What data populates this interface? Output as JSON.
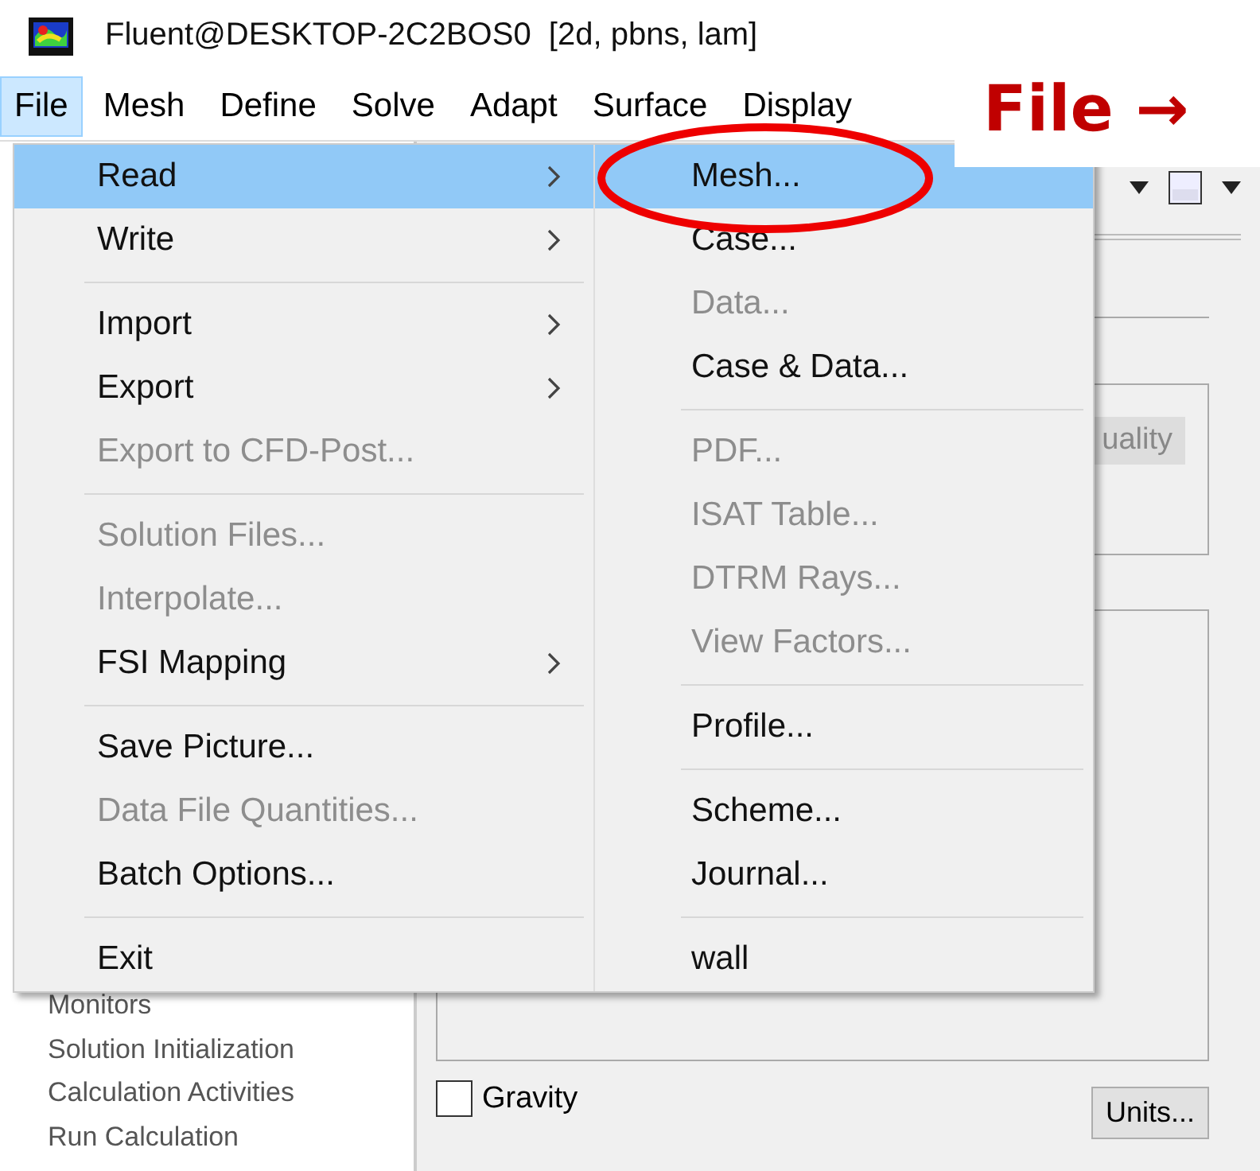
{
  "window": {
    "title": "Fluent@DESKTOP-2C2BOS0  [2d, pbns, lam]"
  },
  "menubar": [
    {
      "label": "File",
      "selected": true
    },
    {
      "label": "Mesh",
      "selected": false
    },
    {
      "label": "Define",
      "selected": false
    },
    {
      "label": "Solve",
      "selected": false
    },
    {
      "label": "Adapt",
      "selected": false
    },
    {
      "label": "Surface",
      "selected": false
    },
    {
      "label": "Display",
      "selected": false
    }
  ],
  "file_menu": [
    {
      "kind": "item",
      "label": "Read",
      "submenu": true,
      "disabled": false,
      "selected": true
    },
    {
      "kind": "item",
      "label": "Write",
      "submenu": true,
      "disabled": false,
      "selected": false
    },
    {
      "kind": "separator"
    },
    {
      "kind": "item",
      "label": "Import",
      "submenu": true,
      "disabled": false,
      "selected": false
    },
    {
      "kind": "item",
      "label": "Export",
      "submenu": true,
      "disabled": false,
      "selected": false
    },
    {
      "kind": "item",
      "label": "Export to CFD-Post...",
      "submenu": false,
      "disabled": true,
      "selected": false
    },
    {
      "kind": "separator"
    },
    {
      "kind": "item",
      "label": "Solution Files...",
      "submenu": false,
      "disabled": true,
      "selected": false
    },
    {
      "kind": "item",
      "label": "Interpolate...",
      "submenu": false,
      "disabled": true,
      "selected": false
    },
    {
      "kind": "item",
      "label": "FSI Mapping",
      "submenu": true,
      "disabled": false,
      "selected": false
    },
    {
      "kind": "separator"
    },
    {
      "kind": "item",
      "label": "Save Picture...",
      "submenu": false,
      "disabled": false,
      "selected": false
    },
    {
      "kind": "item",
      "label": "Data File Quantities...",
      "submenu": false,
      "disabled": true,
      "selected": false
    },
    {
      "kind": "item",
      "label": "Batch Options...",
      "submenu": false,
      "disabled": false,
      "selected": false
    },
    {
      "kind": "separator"
    },
    {
      "kind": "item",
      "label": "Exit",
      "submenu": false,
      "disabled": false,
      "selected": false
    }
  ],
  "read_submenu": [
    {
      "kind": "item",
      "label": "Mesh...",
      "disabled": false,
      "selected": true
    },
    {
      "kind": "item",
      "label": "Case...",
      "disabled": false,
      "selected": false
    },
    {
      "kind": "item",
      "label": "Data...",
      "disabled": true,
      "selected": false
    },
    {
      "kind": "item",
      "label": "Case & Data...",
      "disabled": false,
      "selected": false
    },
    {
      "kind": "separator"
    },
    {
      "kind": "item",
      "label": "PDF...",
      "disabled": true,
      "selected": false
    },
    {
      "kind": "item",
      "label": "ISAT Table...",
      "disabled": true,
      "selected": false
    },
    {
      "kind": "item",
      "label": "DTRM Rays...",
      "disabled": true,
      "selected": false
    },
    {
      "kind": "item",
      "label": "View Factors...",
      "disabled": true,
      "selected": false
    },
    {
      "kind": "separator"
    },
    {
      "kind": "item",
      "label": "Profile...",
      "disabled": false,
      "selected": false
    },
    {
      "kind": "separator"
    },
    {
      "kind": "item",
      "label": "Scheme...",
      "disabled": false,
      "selected": false
    },
    {
      "kind": "item",
      "label": "Journal...",
      "disabled": false,
      "selected": false
    },
    {
      "kind": "separator"
    },
    {
      "kind": "item",
      "label": "wall",
      "disabled": false,
      "selected": false
    }
  ],
  "sidebar": {
    "items": [
      "Monitors",
      "Solution Initialization",
      "Calculation Activities",
      "Run Calculation"
    ]
  },
  "panel": {
    "quality_button": "uality",
    "gravity": {
      "label": "Gravity",
      "checked": false
    },
    "units_button": "Units..."
  },
  "annotation": {
    "text": "File →"
  }
}
